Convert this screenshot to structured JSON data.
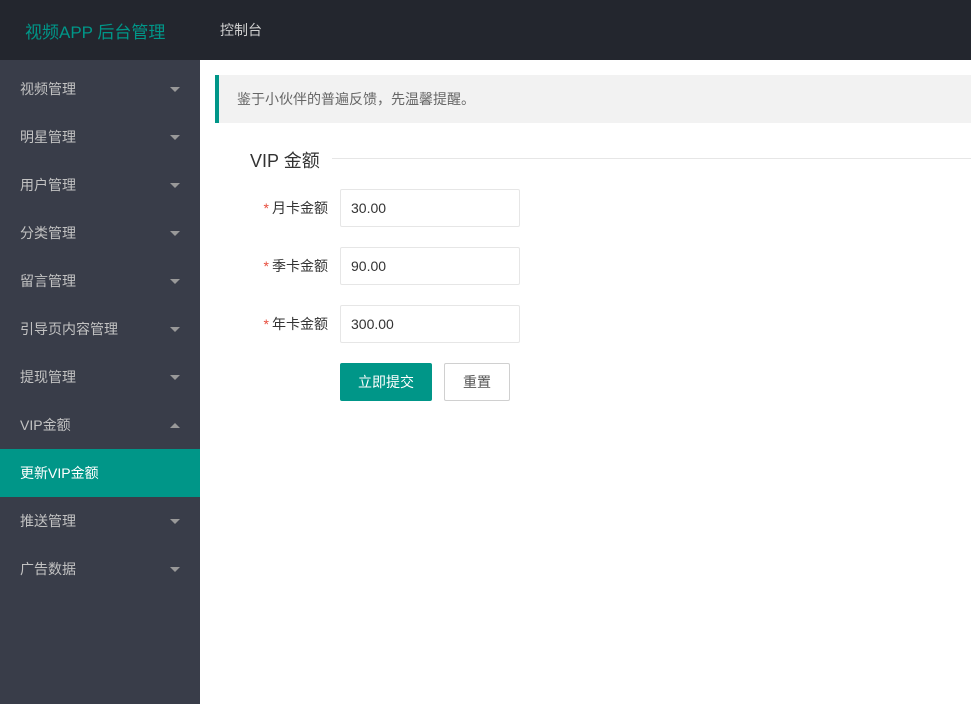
{
  "header": {
    "logo": "视频APP 后台管理",
    "nav": [
      {
        "label": "控制台"
      }
    ]
  },
  "sidebar": {
    "items": [
      {
        "label": "视频管理",
        "expanded": false
      },
      {
        "label": "明星管理",
        "expanded": false
      },
      {
        "label": "用户管理",
        "expanded": false
      },
      {
        "label": "分类管理",
        "expanded": false
      },
      {
        "label": "留言管理",
        "expanded": false
      },
      {
        "label": "引导页内容管理",
        "expanded": false
      },
      {
        "label": "提现管理",
        "expanded": false
      },
      {
        "label": "VIP金额",
        "expanded": true,
        "children": [
          {
            "label": "更新VIP金额",
            "active": true
          }
        ]
      },
      {
        "label": "推送管理",
        "expanded": false
      },
      {
        "label": "广告数据",
        "expanded": false
      }
    ]
  },
  "main": {
    "alert": "鉴于小伙伴的普遍反馈，先温馨提醒。",
    "form": {
      "legend": "VIP 金额",
      "fields": [
        {
          "label": "月卡金额",
          "value": "30.00",
          "required": true
        },
        {
          "label": "季卡金额",
          "value": "90.00",
          "required": true
        },
        {
          "label": "年卡金额",
          "value": "300.00",
          "required": true
        }
      ],
      "submit_label": "立即提交",
      "reset_label": "重置"
    }
  }
}
